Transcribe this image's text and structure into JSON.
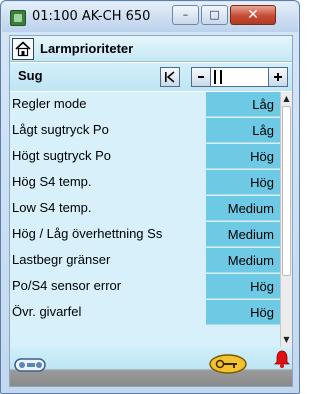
{
  "window": {
    "title": "01:100 AK-CH 650",
    "minimize_label": "–",
    "maximize_label": "□",
    "close_label": "✕"
  },
  "header": {
    "title": "Larmprioriteter"
  },
  "section": {
    "title": "Sug"
  },
  "rows": [
    {
      "label": "Regler mode",
      "value": "Låg"
    },
    {
      "label": "Lågt sugtryck Po",
      "value": "Låg"
    },
    {
      "label": "Högt sugtryck Po",
      "value": "Hög"
    },
    {
      "label": "Hög S4 temp.",
      "value": "Hög"
    },
    {
      "label": "Low S4 temp.",
      "value": "Medium"
    },
    {
      "label": "Hög / Låg överhettning Ss",
      "value": "Medium"
    },
    {
      "label": "Lastbegr gränser",
      "value": "Medium"
    },
    {
      "label": "Po/S4 sensor error",
      "value": "Hög"
    },
    {
      "label": "Övr. givarfel",
      "value": "Hög"
    }
  ],
  "colors": {
    "value_cell": "#6ec9e4",
    "list_background": "#d7f0fa",
    "alarm": "#e01010",
    "key": "#e8a800"
  },
  "icons": {
    "home": "home-icon",
    "first": "first-page-icon",
    "prev": "previous-icon",
    "next": "next-icon",
    "connection": "connection-icon",
    "key": "key-icon",
    "alarm": "alarm-bell-icon"
  }
}
